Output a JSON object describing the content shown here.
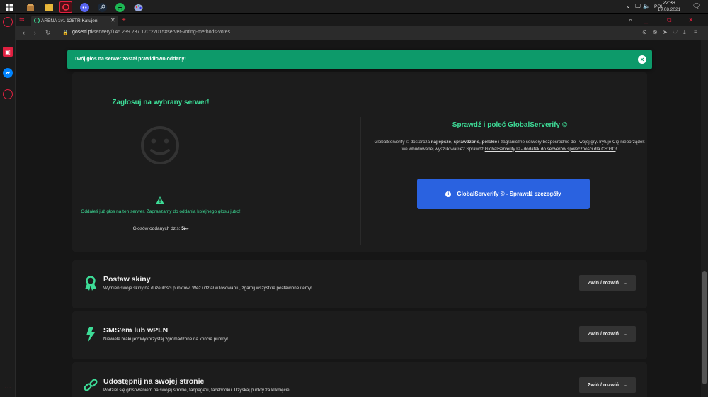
{
  "taskbar": {
    "apps": [
      "windows-logo",
      "explorer",
      "folder",
      "opera-gx",
      "discord",
      "steam",
      "spotify",
      "paint"
    ],
    "language": "POL",
    "time": "22:39",
    "date": "19.08.2021"
  },
  "browser": {
    "tab_title": "ARENA 1v1 128TR Katujeni",
    "url_domain": "gosetti.pl",
    "url_path": "/serwery/145.239.237.170:27015#server-voting-methods-votes"
  },
  "notification": {
    "text": "Twój głos na serwer został prawidłowo oddany!"
  },
  "vote": {
    "title": "Zagłosuj na wybrany serwer!",
    "message": "Oddałeś już głos na ten serwer. Zapraszamy do oddania kolejnego głosu jutro!",
    "votes_today_label": "Głosów oddanych dziś:",
    "votes_today_value": "5/∞"
  },
  "globalserverify": {
    "title_prefix": "Sprawdź i poleć",
    "title_link": "GlobalServerify ©",
    "desc_1": "GlobalServerify © dostarcza ",
    "desc_bold1": "najlepsze",
    "desc_2": ", ",
    "desc_bold2": "sprawdzone",
    "desc_3": ", ",
    "desc_bold3": "polskie",
    "desc_4": " i zagraniczne serwery bezpośrednio do Twojej gry. Irytuje Cię nieporządek we wbudowanej wyszukiwarce? Sprawdź ",
    "desc_link": "GlobalServerify © - dodatek do serwerów społeczności dla CS:GO",
    "desc_5": "!",
    "button": "GlobalServerify © - Sprawdź szczegóły"
  },
  "features": [
    {
      "title": "Postaw skiny",
      "desc": "Wymień swoje skiny na duże ilości punktów! Weź udział w losowaniu, zgarnij wszystkie postawione itemy!",
      "button": "Zwiń / rozwiń"
    },
    {
      "title": "SMS'em lub wPLN",
      "desc": "Niewiele brakuje? Wykorzystaj zgromadzone na koncie punkty!",
      "button": "Zwiń / rozwiń"
    },
    {
      "title": "Udostępnij na swojej stronie",
      "desc": "Podziel się głosowaniem na swojej stronie, fanpage'u, facebooku. Uzyskaj punkty za kliknięcie!",
      "button": "Zwiń / rozwiń"
    }
  ],
  "colors": {
    "accent": "#3ddc97",
    "notification": "#0d9a6a",
    "primary_button": "#2a62e0"
  }
}
